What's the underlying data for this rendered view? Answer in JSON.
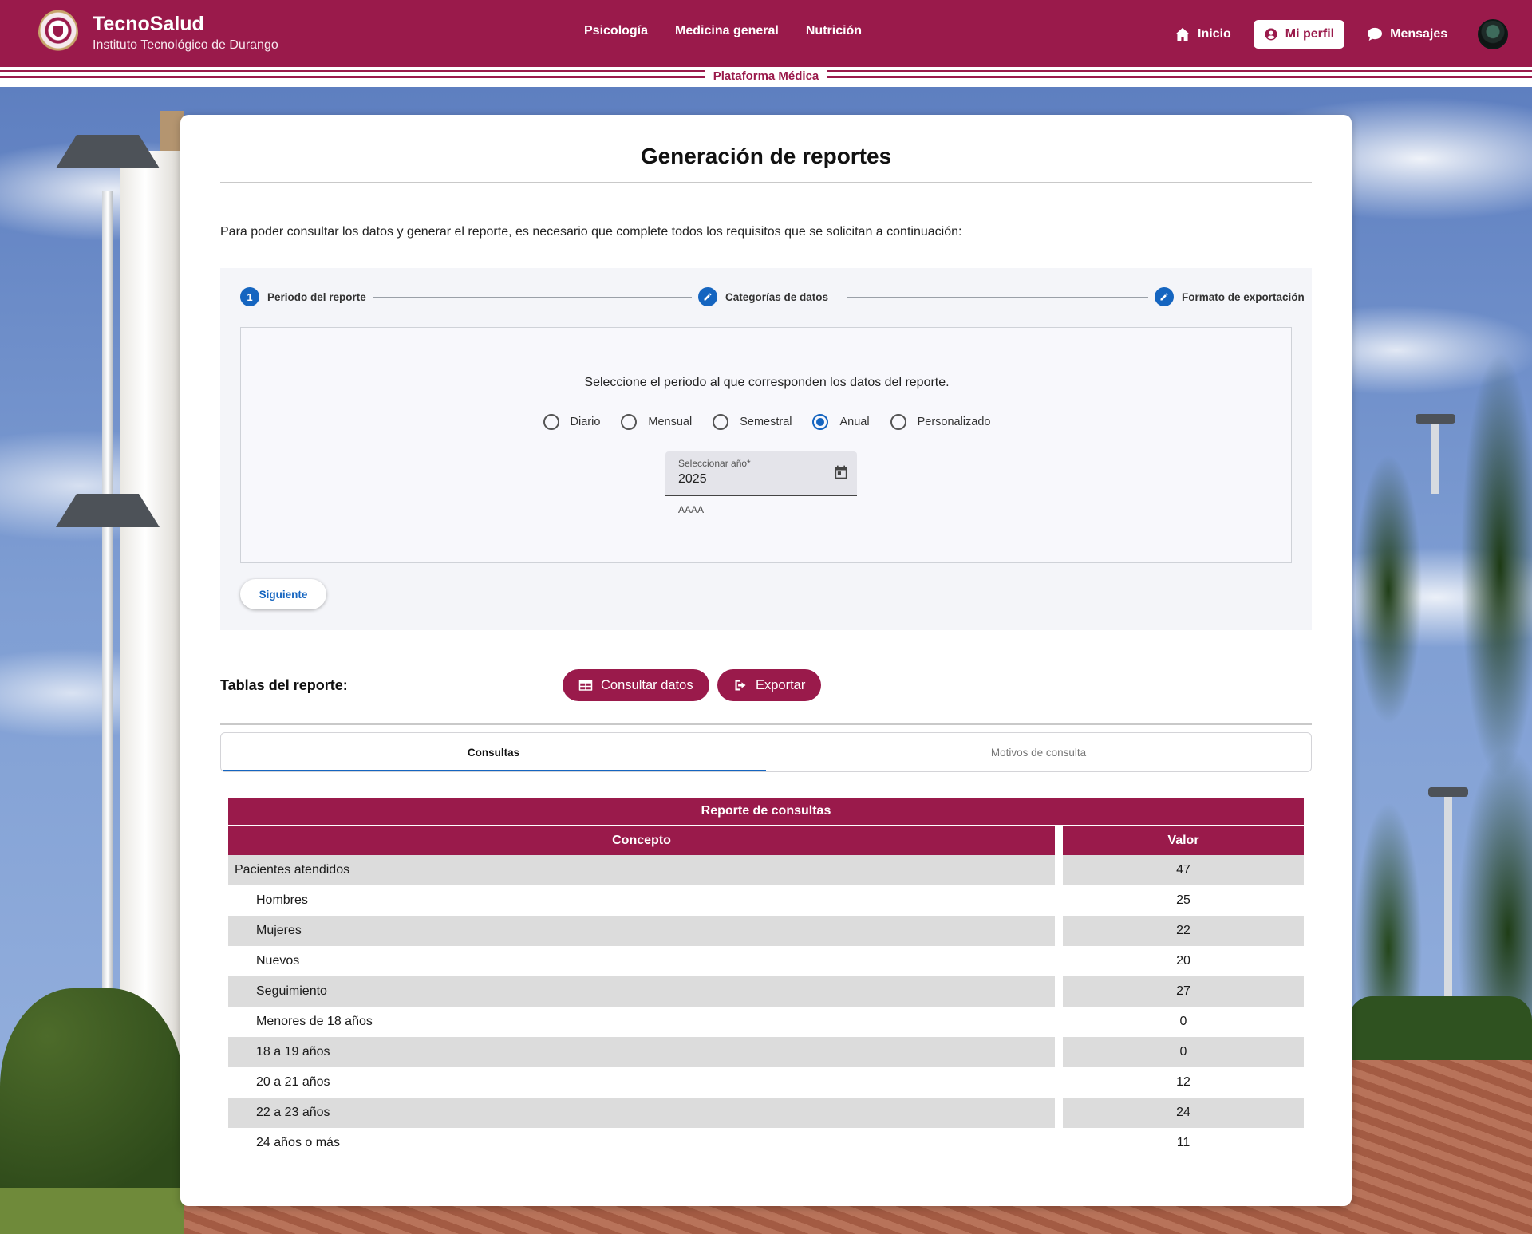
{
  "header": {
    "brand_title": "TecnoSalud",
    "brand_subtitle": "Instituto Tecnológico de Durango",
    "nav": [
      "Psicología",
      "Medicina general",
      "Nutrición"
    ],
    "right_nav": {
      "home": "Inicio",
      "profile": "Mi perfil",
      "messages": "Mensajes"
    },
    "platform_label": "Plataforma Médica",
    "colors": {
      "brand": "#9a1a4b",
      "accent": "#1565c0"
    }
  },
  "page": {
    "title": "Generación de reportes",
    "intro": "Para poder consultar los datos y generar el reporte, es necesario que complete todos los requisitos que se solicitan a continuación:"
  },
  "stepper": {
    "steps": [
      {
        "marker": "1",
        "label": "Periodo del reporte",
        "icon": "number"
      },
      {
        "marker": "",
        "label": "Categorías de datos",
        "icon": "pencil-icon"
      },
      {
        "marker": "",
        "label": "Formato de exportación",
        "icon": "pencil-icon"
      }
    ],
    "period_question": "Seleccione el periodo al que corresponden los datos del reporte.",
    "period_options": [
      "Diario",
      "Mensual",
      "Semestral",
      "Anual",
      "Personalizado"
    ],
    "selected_period": "Anual",
    "year_field": {
      "label": "Seleccionar año*",
      "value": "2025",
      "hint": "AAAA"
    },
    "next_button": "Siguiente"
  },
  "tables": {
    "label": "Tablas del reporte:",
    "consult_button": "Consultar datos",
    "export_button": "Exportar",
    "tabs": [
      "Consultas",
      "Motivos de consulta"
    ],
    "active_tab": "Consultas"
  },
  "report": {
    "caption": "Reporte de consultas",
    "headers": [
      "Concepto",
      "Valor"
    ],
    "rows": [
      {
        "concept": "Pacientes atendidos",
        "value": "47"
      },
      {
        "concept": "Hombres",
        "value": "25"
      },
      {
        "concept": "Mujeres",
        "value": "22"
      },
      {
        "concept": "Nuevos",
        "value": "20"
      },
      {
        "concept": "Seguimiento",
        "value": "27"
      },
      {
        "concept": "Menores de 18 años",
        "value": "0"
      },
      {
        "concept": "18 a 19 años",
        "value": "0"
      },
      {
        "concept": "20 a 21 años",
        "value": "12"
      },
      {
        "concept": "22 a 23 años",
        "value": "24"
      },
      {
        "concept": "24 años o más",
        "value": "11"
      }
    ]
  }
}
